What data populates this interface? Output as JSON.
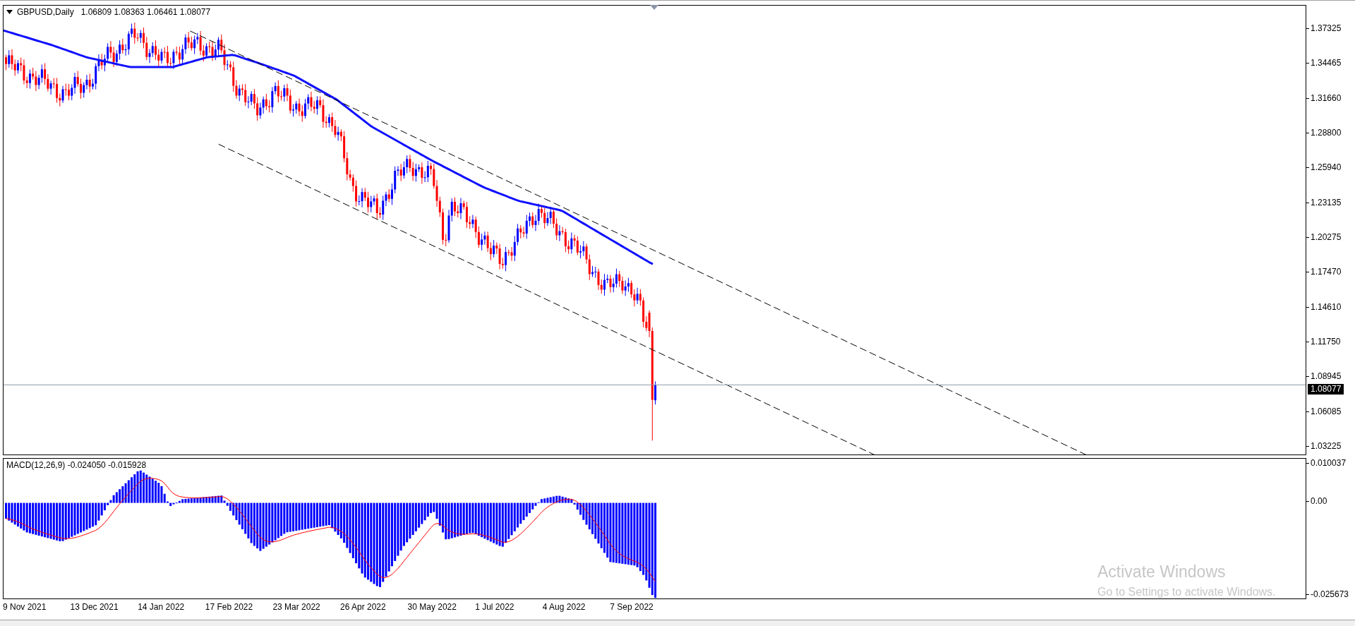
{
  "chart_header": {
    "symbol": "GBPUSD,Daily",
    "ohlc": "1.06809 1.08363 1.06461 1.08077"
  },
  "price_axis": {
    "ticks": [
      "1.37325",
      "1.34465",
      "1.31660",
      "1.28800",
      "1.25940",
      "1.23135",
      "1.20275",
      "1.17470",
      "1.14610",
      "1.11750",
      "1.08945",
      "1.06085",
      "1.03225"
    ],
    "current_price": "1.08077"
  },
  "macd": {
    "label": "MACD(12,26,9) -0.024050 -0.015928",
    "axis_ticks": [
      "0.010037",
      "0.00",
      "-0.025673"
    ]
  },
  "date_axis": [
    "9 Nov 2021",
    "13 Dec 2021",
    "14 Jan 2022",
    "17 Feb 2022",
    "23 Mar 2022",
    "26 Apr 2022",
    "30 May 2022",
    "1 Jul 2022",
    "4 Aug 2022",
    "7 Sep 2022"
  ],
  "os_notice": {
    "title": "Activate Windows",
    "subtitle": "Go to Settings to activate Windows."
  }
}
